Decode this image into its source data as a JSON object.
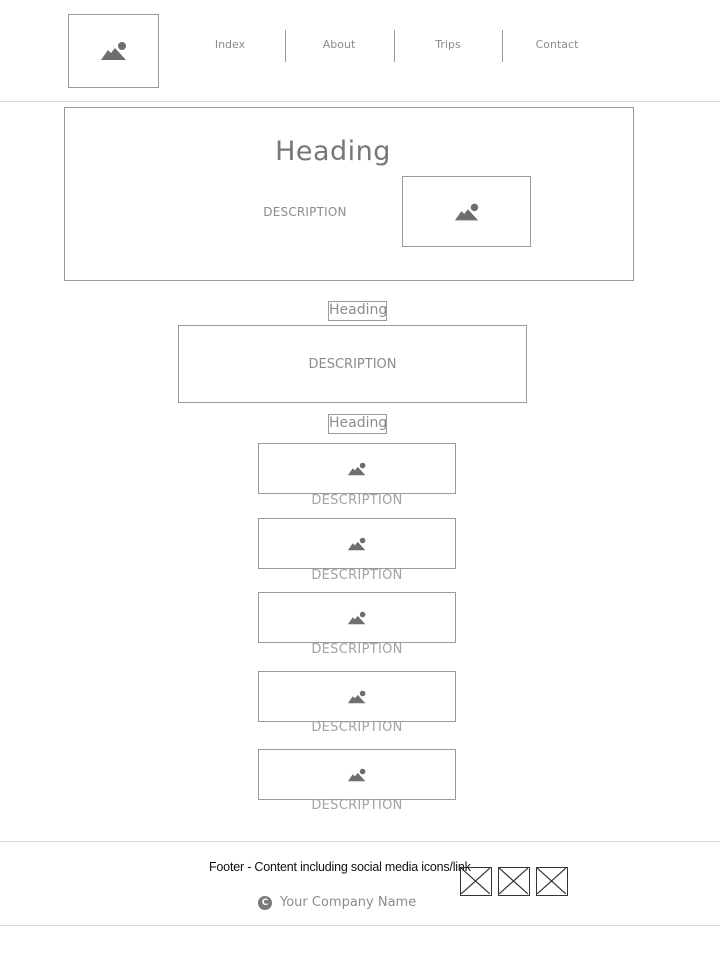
{
  "nav": {
    "links": [
      "Index",
      "About",
      "Trips",
      "Contact"
    ]
  },
  "hero": {
    "heading": "Heading",
    "description": "DESCRIPTION"
  },
  "section1": {
    "heading": "Heading",
    "description": "DESCRIPTION"
  },
  "section2": {
    "heading": "Heading",
    "cards": [
      {
        "description": "DESCRIPTION"
      },
      {
        "description": "DESCRIPTION"
      },
      {
        "description": "DESCRIPTION"
      },
      {
        "description": "DESCRIPTION"
      },
      {
        "description": "DESCRIPTION"
      }
    ]
  },
  "footer": {
    "text": "Footer - Content including social media icons/link",
    "copyright_symbol": "C",
    "company": "Your Company Name",
    "social_icons": [
      "social-icon-1",
      "social-icon-2",
      "social-icon-3"
    ]
  },
  "colors": {
    "wireframe_border": "#9a9a9a",
    "icon_fill": "#6e6e6e",
    "text_gray": "#8c8c8c"
  }
}
